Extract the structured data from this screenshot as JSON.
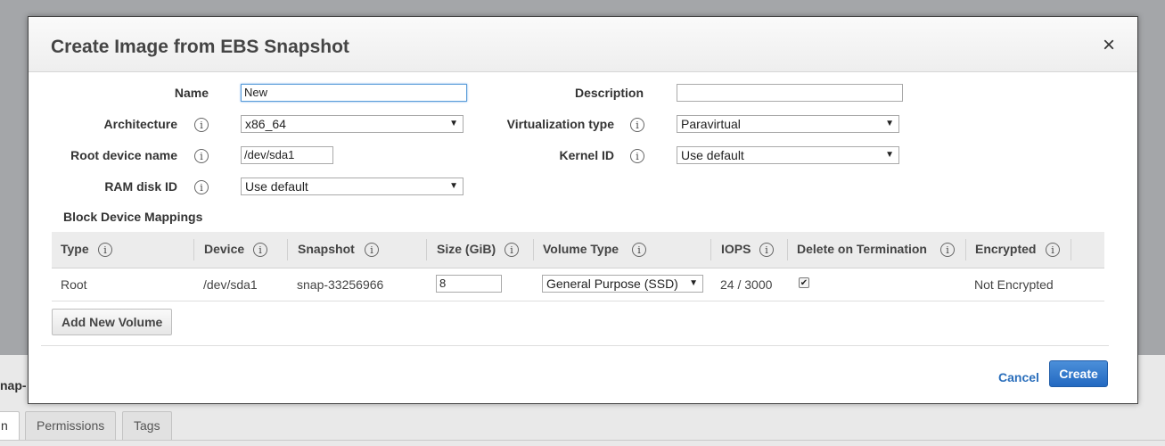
{
  "background": {
    "snap_text": "nap-",
    "tabs": [
      {
        "label": "n"
      },
      {
        "label": "Permissions"
      },
      {
        "label": "Tags"
      }
    ]
  },
  "modal": {
    "title": "Create Image from EBS Snapshot",
    "close_icon": "×",
    "info_glyph": "i",
    "fields": {
      "name": {
        "label": "Name",
        "value": "New"
      },
      "description": {
        "label": "Description",
        "value": ""
      },
      "architecture": {
        "label": "Architecture",
        "value": "x86_64"
      },
      "virtualization_type": {
        "label": "Virtualization type",
        "value": "Paravirtual"
      },
      "root_device_name": {
        "label": "Root device name",
        "value": "/dev/sda1"
      },
      "kernel_id": {
        "label": "Kernel ID",
        "value": "Use default"
      },
      "ram_disk_id": {
        "label": "RAM disk ID",
        "value": "Use default"
      }
    },
    "block_device": {
      "title": "Block Device Mappings",
      "columns": [
        "Type",
        "Device",
        "Snapshot",
        "Size (GiB)",
        "Volume Type",
        "IOPS",
        "Delete on Termination",
        "Encrypted"
      ],
      "rows": [
        {
          "type": "Root",
          "device": "/dev/sda1",
          "snapshot": "snap-33256966",
          "size": "8",
          "volume_type": "General Purpose (SSD)",
          "iops": "24 / 3000",
          "delete_on_termination": true,
          "encrypted": "Not Encrypted"
        }
      ],
      "add_button": "Add New Volume"
    },
    "footer": {
      "cancel": "Cancel",
      "create": "Create"
    }
  },
  "colors": {
    "overlay": "#a4a6a9",
    "primary_button": "#2369c1",
    "link": "#2a6ebb"
  },
  "icons": {
    "close": "close-icon",
    "info": "info-icon",
    "dropdown": "chevron-down-icon",
    "checkbox": "checkmark-icon"
  }
}
